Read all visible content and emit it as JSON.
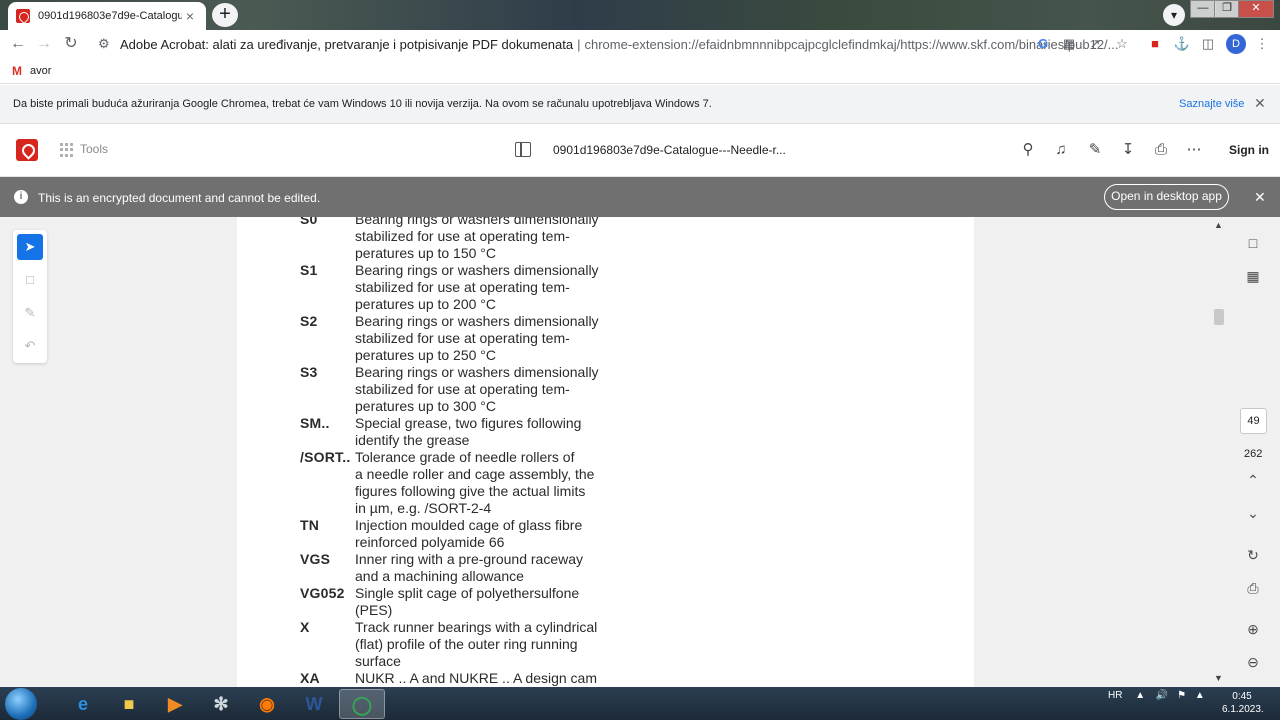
{
  "browser": {
    "tab_title": "0901d196803e7d9e-Catalogue-···",
    "tab_close": "×",
    "new_tab": "+",
    "omnibox_site": "Adobe Acrobat: alati za uređivanje, pretvaranje i potpisivanje PDF dokumenata",
    "omnibox_separator": "|",
    "omnibox_url": "chrome-extension://efaidnbmnnnibpcajpcglclefindmkaj/https://www.skf.com/binaries/pub12/...",
    "profile_initial": "D",
    "bookmark": "avor"
  },
  "infobar": {
    "message": "Da biste primali buduća ažuriranja Google Chromea, trebat će vam Windows 10 ili novija verzija. Na ovom se računalu upotrebljava Windows 7.",
    "link": "Saznajte više",
    "close": "✕"
  },
  "acrobat": {
    "tools_label": "Tools",
    "doc_name": "0901d196803e7d9e-Catalogue---Needle-r...",
    "sign_in": "Sign in",
    "encrypted_message": "This is an encrypted document and cannot be edited.",
    "open_desktop": "Open in desktop app",
    "close": "✕",
    "page_current": "49",
    "page_total": "262"
  },
  "document": {
    "entries": [
      {
        "code": "S0",
        "lines": [
          "Bearing rings or washers dimensionally",
          "stabilized for use at operating tem-",
          "peratures up to 150 °C"
        ]
      },
      {
        "code": "S1",
        "lines": [
          "Bearing rings or washers dimensionally",
          "stabilized for use at operating tem-",
          "peratures up to 200 °C"
        ]
      },
      {
        "code": "S2",
        "lines": [
          "Bearing rings or washers dimensionally",
          "stabilized for use at operating tem-",
          "peratures up to 250 °C"
        ]
      },
      {
        "code": "S3",
        "lines": [
          "Bearing rings or washers dimensionally",
          "stabilized for use at operating tem-",
          "peratures up to 300 °C"
        ]
      },
      {
        "code": "SM..",
        "lines": [
          "Special grease, two figures following",
          "identify the grease"
        ]
      },
      {
        "code": "/SORT..",
        "lines": [
          "Tolerance grade of needle rollers of",
          "a needle roller and cage assembly, the",
          "figures following give the actual limits",
          "in µm, e.g. /SORT-2-4"
        ]
      },
      {
        "code": "TN",
        "lines": [
          "Injection moulded cage of glass fibre",
          "reinforced polyamide 66"
        ]
      },
      {
        "code": "VGS",
        "lines": [
          "Inner ring with a pre-ground raceway",
          "and a machining allowance"
        ]
      },
      {
        "code": "VG052",
        "lines": [
          "Single split cage of polyethersulfone",
          "(PES)"
        ]
      },
      {
        "code": "X",
        "lines": [
          "Track runner bearings with a cylindrical",
          "(flat) profile of the outer ring running",
          "surface"
        ]
      },
      {
        "code": "XA",
        "lines": [
          "NUKR .. A and NUKRE .. A design cam"
        ]
      }
    ]
  },
  "taskbar": {
    "language": "HR",
    "time": "0:45",
    "date": "6.1.2023."
  }
}
